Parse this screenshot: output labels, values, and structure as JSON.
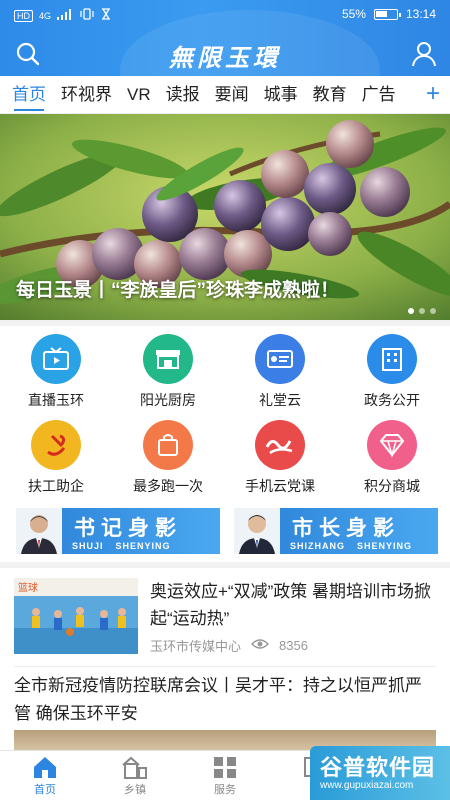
{
  "status_bar": {
    "network_badge": "HD",
    "network": "4G",
    "battery": "55%",
    "time": "13:14"
  },
  "header": {
    "title": "無限玉環"
  },
  "tabs": [
    {
      "label": "首页",
      "active": true
    },
    {
      "label": "环视界"
    },
    {
      "label": "VR"
    },
    {
      "label": "读报"
    },
    {
      "label": "要闻"
    },
    {
      "label": "城事"
    },
    {
      "label": "教育"
    },
    {
      "label": "广告"
    }
  ],
  "tab_add_label": "+",
  "banner": {
    "caption": "每日玉景丨“李族皇后”珍珠李成熟啦！",
    "page_count": 3,
    "current_page": 1
  },
  "grid": [
    {
      "label": "直播玉环",
      "icon": "tv-icon",
      "color": "#2aa3e6"
    },
    {
      "label": "阳光厨房",
      "icon": "kitchen-icon",
      "color": "#23b88a"
    },
    {
      "label": "礼堂云",
      "icon": "hall-icon",
      "color": "#3a7ee6"
    },
    {
      "label": "政务公开",
      "icon": "building-icon",
      "color": "#2a8ce8"
    },
    {
      "label": "扶工助企",
      "icon": "party-icon",
      "color": "#f2b720"
    },
    {
      "label": "最多跑一次",
      "icon": "bag-icon",
      "color": "#f37a48"
    },
    {
      "label": "手机云党课",
      "icon": "study-icon",
      "color": "#e94a4a"
    },
    {
      "label": "积分商城",
      "icon": "diamond-icon",
      "color": "#f0608a"
    }
  ],
  "leaders": [
    {
      "title": "书记身影",
      "pinyin": [
        "SHUJI",
        "SHENYING"
      ]
    },
    {
      "title": "市长身影",
      "pinyin": [
        "SHIZHANG",
        "SHENYING"
      ]
    }
  ],
  "news": [
    {
      "title": "奥运效应+“双减”政策  暑期培训市场掀起“运动热”",
      "source": "玉环市传媒中心",
      "views": "8356"
    },
    {
      "title": "全市新冠疫情防控联席会议丨吴才平：持之以恒严抓严管 确保玉环平安"
    }
  ],
  "bottom_nav": [
    {
      "label": "首页",
      "active": true
    },
    {
      "label": "乡镇"
    },
    {
      "label": "服务"
    },
    {
      "label": "点"
    }
  ],
  "watermark": {
    "text": "谷普软件园",
    "url": "www.gupuxiazai.com"
  },
  "colors": {
    "brand": "#2c85e0",
    "header_bg": "#3a9bf0"
  }
}
